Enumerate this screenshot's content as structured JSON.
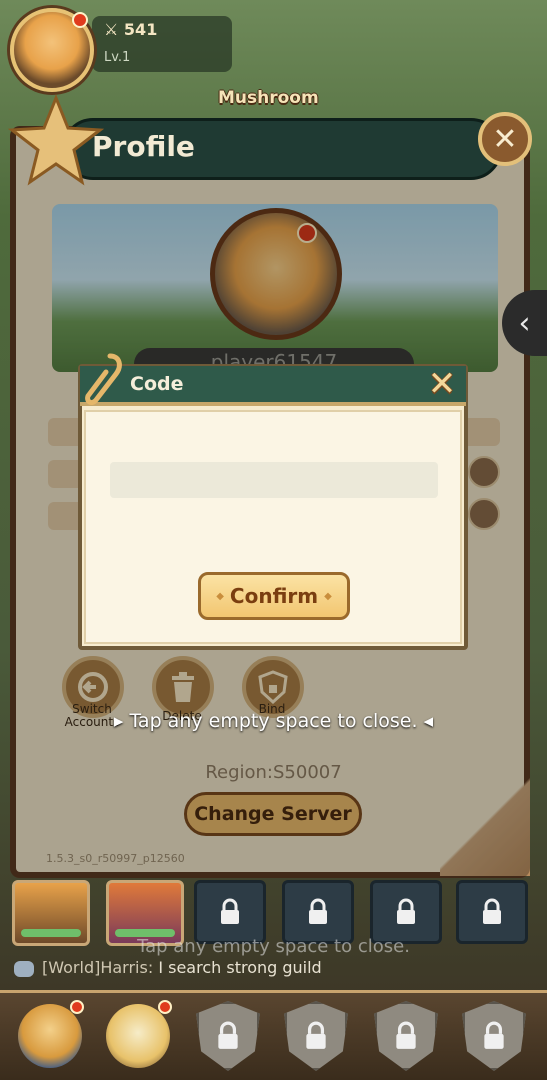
{
  "hud": {
    "power": "541",
    "level": "Lv.1",
    "map_label": "Mushroom"
  },
  "profile": {
    "title": "Profile",
    "player_name": "player61547",
    "actions": [
      {
        "label": "Switch Accounts",
        "icon": "switch-account-icon"
      },
      {
        "label": "Delete",
        "icon": "trash-icon"
      },
      {
        "label": "Bind",
        "icon": "shield-lock-icon"
      }
    ],
    "region": "Region:S50007",
    "change_server": "Change Server",
    "version": "1.5.3_s0_r50997_p12560"
  },
  "code_dialog": {
    "title": "Code",
    "input_value": "",
    "confirm": "Confirm"
  },
  "close_hint": "Tap any empty space to close.",
  "close_hint_ghost": "Tap any empty space to close.",
  "chat": {
    "sender": "[World]Harris:",
    "message": "I search strong guild"
  },
  "colors": {
    "panel_header": "#1f3a33",
    "dialog_header": "#2f5a4a",
    "confirm_button": "#f2c671",
    "badge_red": "#e03b1d"
  }
}
